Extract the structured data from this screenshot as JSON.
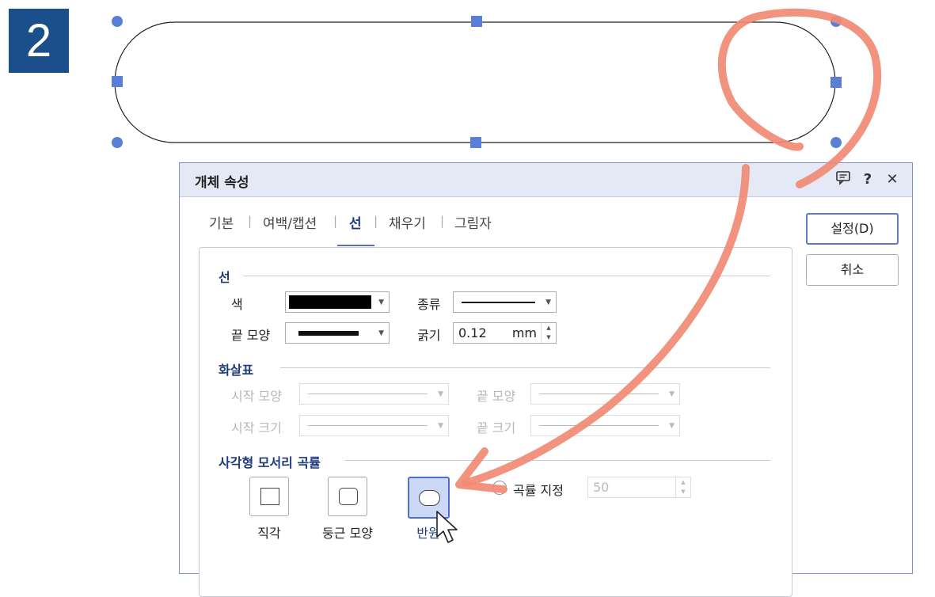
{
  "step": {
    "number": "2"
  },
  "dialog": {
    "title": "개체 속성",
    "titlebar_icons": [
      "comment-icon",
      "help-icon",
      "close-icon"
    ],
    "help_glyph": "?",
    "close_glyph": "✕",
    "tabs": [
      {
        "label": "기본",
        "active": false
      },
      {
        "label": "여백/캡션",
        "active": false
      },
      {
        "label": "선",
        "active": true
      },
      {
        "label": "채우기",
        "active": false
      },
      {
        "label": "그림자",
        "active": false
      }
    ],
    "tab_separator": "|",
    "buttons": {
      "ok_label": "설정(D)",
      "cancel_label": "취소"
    },
    "line_section": {
      "title": "선",
      "color_label": "색",
      "color_value": "#000000",
      "type_label": "종류",
      "end_shape_label": "끝 모양",
      "thickness_label": "굵기",
      "thickness_value": "0.12",
      "thickness_unit": "mm"
    },
    "arrow_section": {
      "title": "화살표",
      "start_shape_label": "시작 모양",
      "end_shape_label": "끝 모양",
      "start_size_label": "시작 크기",
      "end_size_label": "끝 크기"
    },
    "corner_section": {
      "title": "사각형 모서리 곡률",
      "options": [
        {
          "label": "직각",
          "selected": false
        },
        {
          "label": "둥근 모양",
          "selected": false
        },
        {
          "label": "반원",
          "selected": true
        }
      ],
      "custom_radio_label": "곡률 지정",
      "custom_value": "50"
    }
  },
  "colors": {
    "accent": "#1f3a7a",
    "badge": "#1a4f8b",
    "handle": "#5b7fd9",
    "annotation_arrow": "#f08a74"
  }
}
